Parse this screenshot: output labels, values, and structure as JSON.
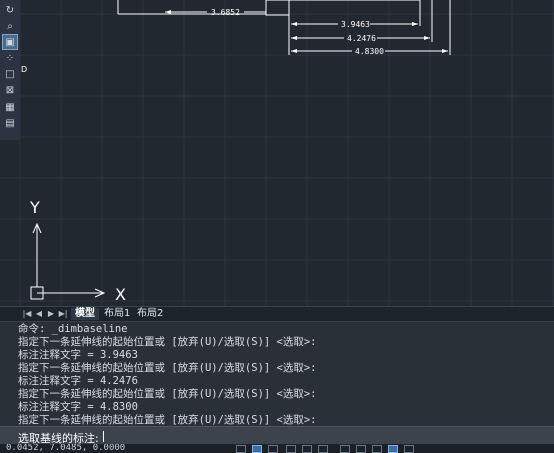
{
  "toolbar": {
    "items": [
      {
        "icon": "orbit-icon",
        "glyph": "↻",
        "active": false
      },
      {
        "icon": "zoom-window-icon",
        "glyph": "⌕",
        "active": false
      },
      {
        "icon": "viewport-icon",
        "glyph": "▣",
        "active": true
      },
      {
        "icon": "snap-icon",
        "glyph": "⁘",
        "active": false
      },
      {
        "icon": "rectangle-icon",
        "glyph": "□",
        "active": false
      },
      {
        "icon": "region-icon",
        "glyph": "⊠",
        "active": false
      },
      {
        "icon": "grid-icon",
        "glyph": "▦",
        "active": false
      },
      {
        "icon": "sheet-icon",
        "glyph": "▤",
        "active": false
      }
    ]
  },
  "drawing": {
    "dimensions": [
      {
        "value": "3.6852"
      },
      {
        "value": "3.9463"
      },
      {
        "value": "4.2476"
      },
      {
        "value": "4.8300"
      }
    ],
    "ucs": {
      "x_label": "X",
      "y_label": "Y"
    },
    "colors": {
      "background": "#212830",
      "grid": "#2c3540",
      "lines": "#ffffff"
    }
  },
  "tabs": {
    "nav": [
      "|◀",
      "◀",
      "▶",
      "▶|"
    ],
    "items": [
      {
        "label": "模型",
        "active": true
      },
      {
        "label": "布局1",
        "active": false
      },
      {
        "label": "布局2",
        "active": false
      }
    ]
  },
  "command": {
    "history": [
      "命令: _dimbaseline",
      "指定下一条延伸线的起始位置或 [放弃(U)/选取(S)] <选取>:",
      "标注注释文字 = 3.9463",
      "指定下一条延伸线的起始位置或 [放弃(U)/选取(S)] <选取>:",
      "标注注释文字 = 4.2476",
      "指定下一条延伸线的起始位置或 [放弃(U)/选取(S)] <选取>:",
      "标注注释文字 = 4.8300",
      "指定下一条延伸线的起始位置或 [放弃(U)/选取(S)] <选取>:"
    ],
    "prompt": "选取基线的标注: "
  },
  "status": {
    "coordinates": "0.0452, 7.0485, 0.0000"
  }
}
